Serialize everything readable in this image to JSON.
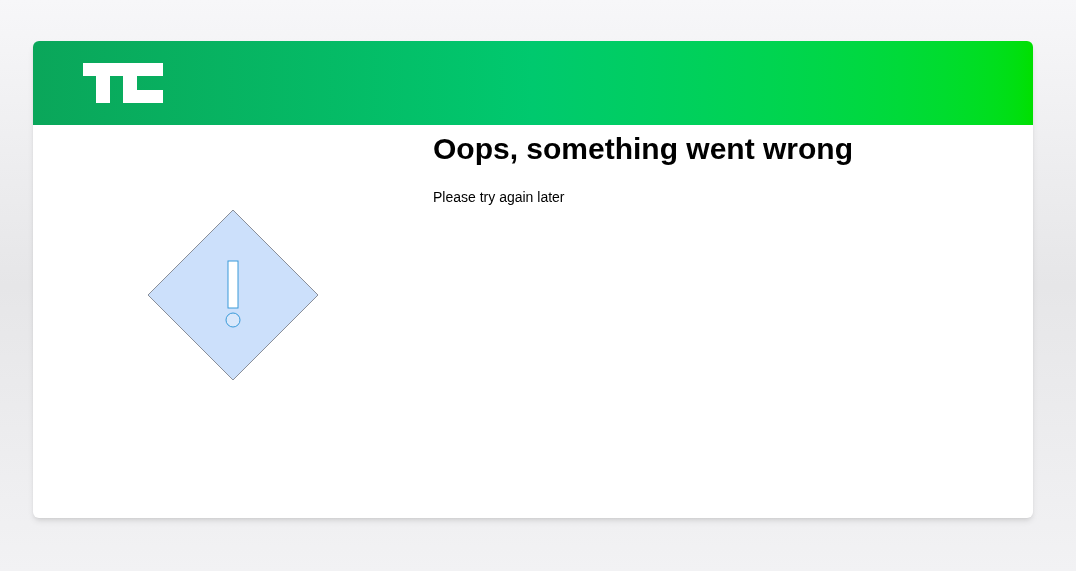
{
  "error": {
    "title": "Oops, something went wrong",
    "message": "Please try again later"
  }
}
